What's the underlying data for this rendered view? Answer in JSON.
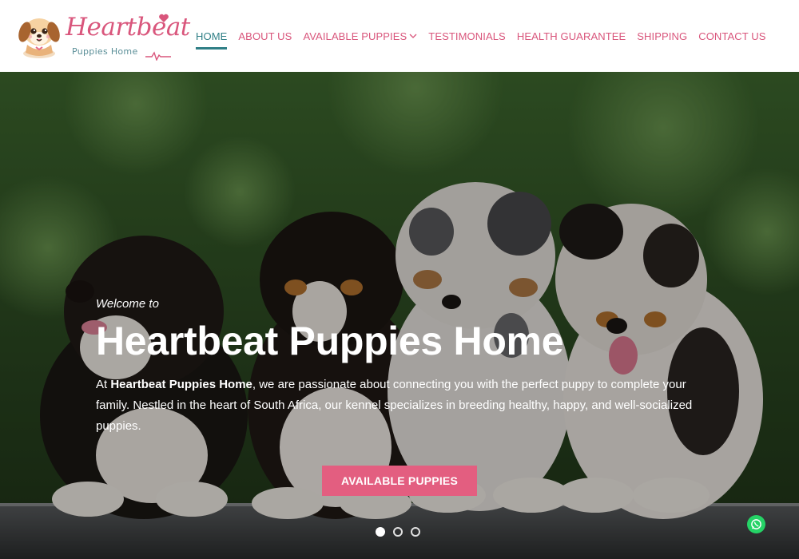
{
  "brand": {
    "name": "Heartbeat",
    "tagline": "Puppies Home",
    "logo_icon": "puppy-face-icon",
    "accent_color": "#d9567c",
    "secondary_color": "#2f7f86"
  },
  "nav": {
    "items": [
      {
        "label": "HOME",
        "active": true
      },
      {
        "label": "ABOUT US",
        "active": false
      },
      {
        "label": "AVAILABLE PUPPIES",
        "active": false,
        "has_dropdown": true
      },
      {
        "label": "TESTIMONIALS",
        "active": false
      },
      {
        "label": "HEALTH GUARANTEE",
        "active": false
      },
      {
        "label": "SHIPPING",
        "active": false
      },
      {
        "label": "CONTACT US",
        "active": false
      }
    ]
  },
  "hero": {
    "kicker": "Welcome to",
    "title": "Heartbeat Puppies Home",
    "desc_lead": "At ",
    "desc_brand": "Heartbeat Puppies Home",
    "desc_rest": ", we are passionate about connecting you with the perfect puppy to complete your family. Nestled in the heart of South Africa, our kennel specializes in breeding healthy, happy, and well-socialized puppies.",
    "cta_label": "AVAILABLE PUPPIES",
    "cta_color": "#e35e80",
    "slides_total": 3,
    "slide_active": 1
  },
  "chat": {
    "icon": "whatsapp-icon"
  }
}
